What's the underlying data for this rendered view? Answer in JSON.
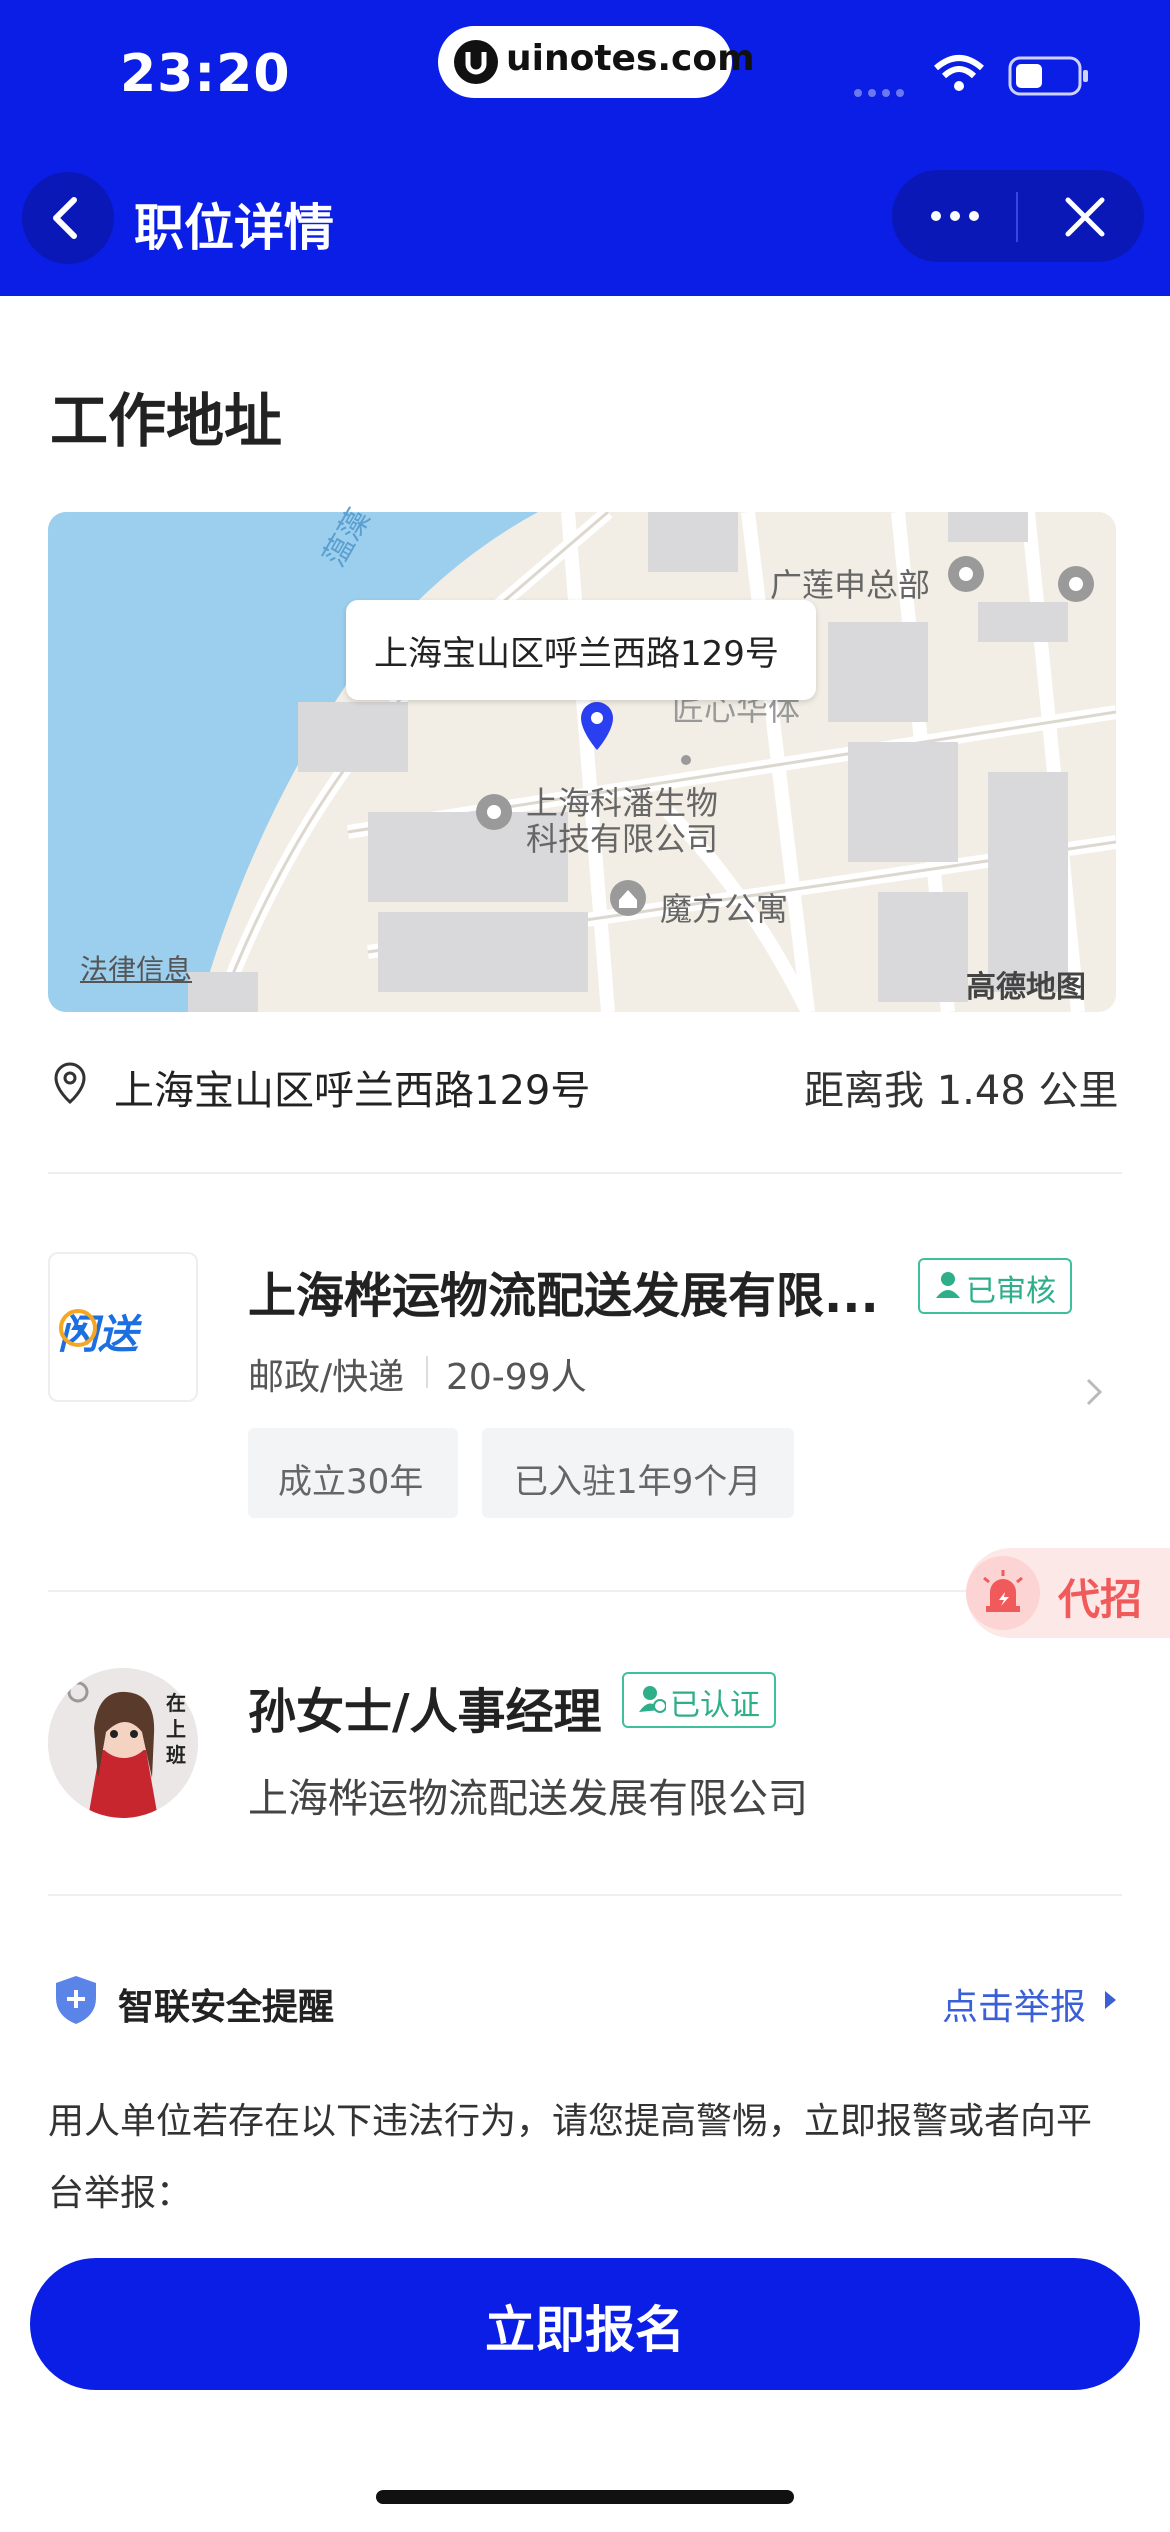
{
  "status_bar": {
    "time": "23:20",
    "url": "uinotes.com"
  },
  "header": {
    "title": "职位详情",
    "back_icon": "chevron-left-icon",
    "more_icon": "more-dots-icon",
    "close_icon": "close-icon"
  },
  "section": {
    "title": "工作地址"
  },
  "map": {
    "popup_address": "上海宝山区呼兰西路129号",
    "pois": [
      "广莲申总部",
      "上海科潘生物",
      "科技有限公司",
      "魔方公寓",
      "匠心华体"
    ],
    "river_label": "蕰藻",
    "legal": "法律信息",
    "brand": "高德地图"
  },
  "address": {
    "text": "上海宝山区呼兰西路129号",
    "distance": "距离我 1.48 公里"
  },
  "company": {
    "logo_text": "闪送",
    "name": "上海桦运物流配送发展有限...",
    "badge": "已审核",
    "industry": "邮政/快递",
    "size": "20-99人",
    "tags": [
      "成立30年",
      "已入驻1年9个月"
    ]
  },
  "recruit_badge": {
    "text": "代招"
  },
  "recruiter": {
    "name": "孙女士/人事经理",
    "badge": "已认证",
    "company": "上海桦运物流配送发展有限公司",
    "avatar_text": "在上班"
  },
  "safety": {
    "title": "智联安全提醒",
    "report": "点击举报",
    "body": "用人单位若存在以下违法行为，请您提高警惕，立即报警或者向平台举报："
  },
  "cta": {
    "label": "立即报名"
  },
  "colors": {
    "brand_blue": "#0b1ee6",
    "verified_green": "#2fae8a",
    "recruit_red": "#f15a5a"
  }
}
